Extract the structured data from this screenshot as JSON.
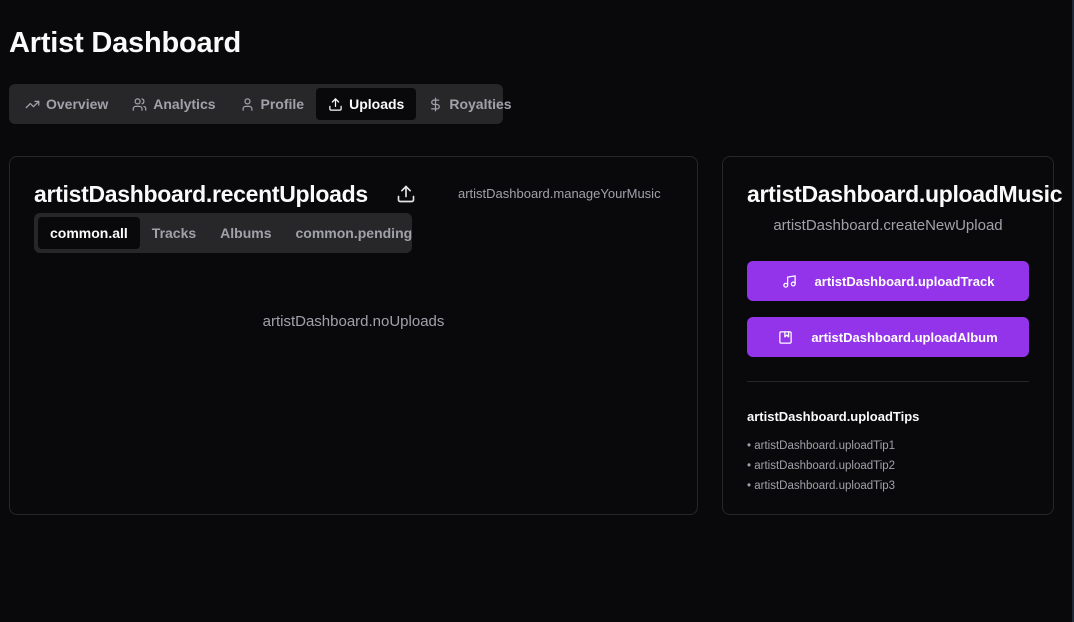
{
  "page": {
    "title": "Artist Dashboard"
  },
  "main_tabs": [
    {
      "label": "Overview",
      "icon": "trending-up-icon",
      "active": false
    },
    {
      "label": "Analytics",
      "icon": "users-icon",
      "active": false
    },
    {
      "label": "Profile",
      "icon": "user-icon",
      "active": false
    },
    {
      "label": "Uploads",
      "icon": "upload-icon",
      "active": true
    },
    {
      "label": "Royalties",
      "icon": "dollar-icon",
      "active": false
    }
  ],
  "recent": {
    "title": "artistDashboard.recentUploads",
    "manage": "artistDashboard.manageYourMusic",
    "tabs": [
      {
        "label": "common.all",
        "active": true
      },
      {
        "label": "Tracks",
        "active": false
      },
      {
        "label": "Albums",
        "active": false
      },
      {
        "label": "common.pending",
        "active": false
      }
    ],
    "empty": "artistDashboard.noUploads"
  },
  "upload": {
    "title": "artistDashboard.uploadMusic",
    "subtitle": "artistDashboard.createNewUpload",
    "track_button": "artistDashboard.uploadTrack",
    "album_button": "artistDashboard.uploadAlbum",
    "tips_title": "artistDashboard.uploadTips",
    "tips": [
      "• artistDashboard.uploadTip1",
      "• artistDashboard.uploadTip2",
      "• artistDashboard.uploadTip3"
    ]
  },
  "colors": {
    "background": "#09090b",
    "tab_bar": "#27272a",
    "accent_purple": "#9333ea",
    "muted_text": "#a1a1aa"
  }
}
